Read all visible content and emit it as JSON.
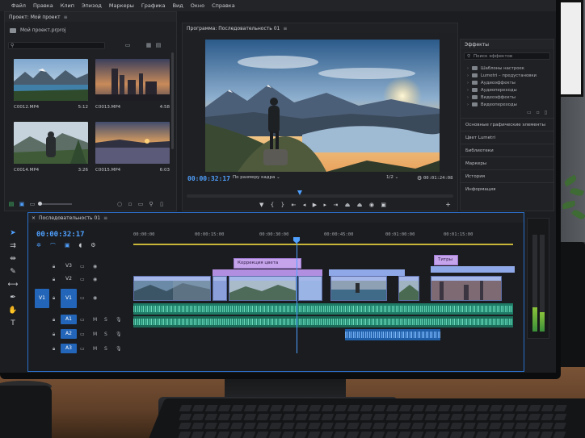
{
  "menu": [
    "Файл",
    "Правка",
    "Клип",
    "Эпизод",
    "Маркеры",
    "Графика",
    "Вид",
    "Окно",
    "Справка"
  ],
  "project_panel": {
    "tab": "Проект: Мой проект",
    "menu_glyph": "≡",
    "file": "Мой проект.prproj",
    "clips": [
      {
        "name": "C0012.MP4",
        "duration": "5:12"
      },
      {
        "name": "C0013.MP4",
        "duration": "4:58"
      },
      {
        "name": "C0014.MP4",
        "duration": "3:26"
      },
      {
        "name": "C0015.MP4",
        "duration": "6:03"
      }
    ]
  },
  "program_monitor": {
    "title": "Программа: Последовательность 01",
    "menu_glyph": "≡",
    "timecode": "00:00:32:17",
    "fit": "По размеру кадра",
    "resolution": "1/2",
    "duration": "00:01:24:08"
  },
  "effects_panel": {
    "title": "Эффекты",
    "search_placeholder": "Поиск эффектов",
    "folders": [
      "Шаблоны настроек",
      "Lumetri – предустановки",
      "Аудиоэффекты",
      "Аудиопереходы",
      "Видеоэффекты",
      "Видеопереходы"
    ],
    "sections": [
      "Основные графические элементы",
      "Цвет Lumetri",
      "Библиотеки",
      "Маркеры",
      "История",
      "Информация"
    ]
  },
  "timeline": {
    "tab": "Последовательность 01",
    "menu_glyph": "≡",
    "timecode": "00:00:32:17",
    "ruler": [
      "00:00:00",
      "00:00:15:00",
      "00:00:30:00",
      "00:00:45:00",
      "00:01:00:00",
      "00:01:15:00"
    ],
    "video_tracks": [
      "V3",
      "V2",
      "V1"
    ],
    "audio_tracks": [
      "A1",
      "A2",
      "A3"
    ],
    "source_patch": "V1",
    "track_labels_m": "M",
    "track_labels_s": "S",
    "title_clips": [
      "Коррекция цвета",
      "Титры"
    ]
  },
  "colors": {
    "accent": "#4fa0ff",
    "panel_bg": "#1f2023",
    "audio_clip": "#1f7b66",
    "title_clip": "#c6a4ec"
  }
}
